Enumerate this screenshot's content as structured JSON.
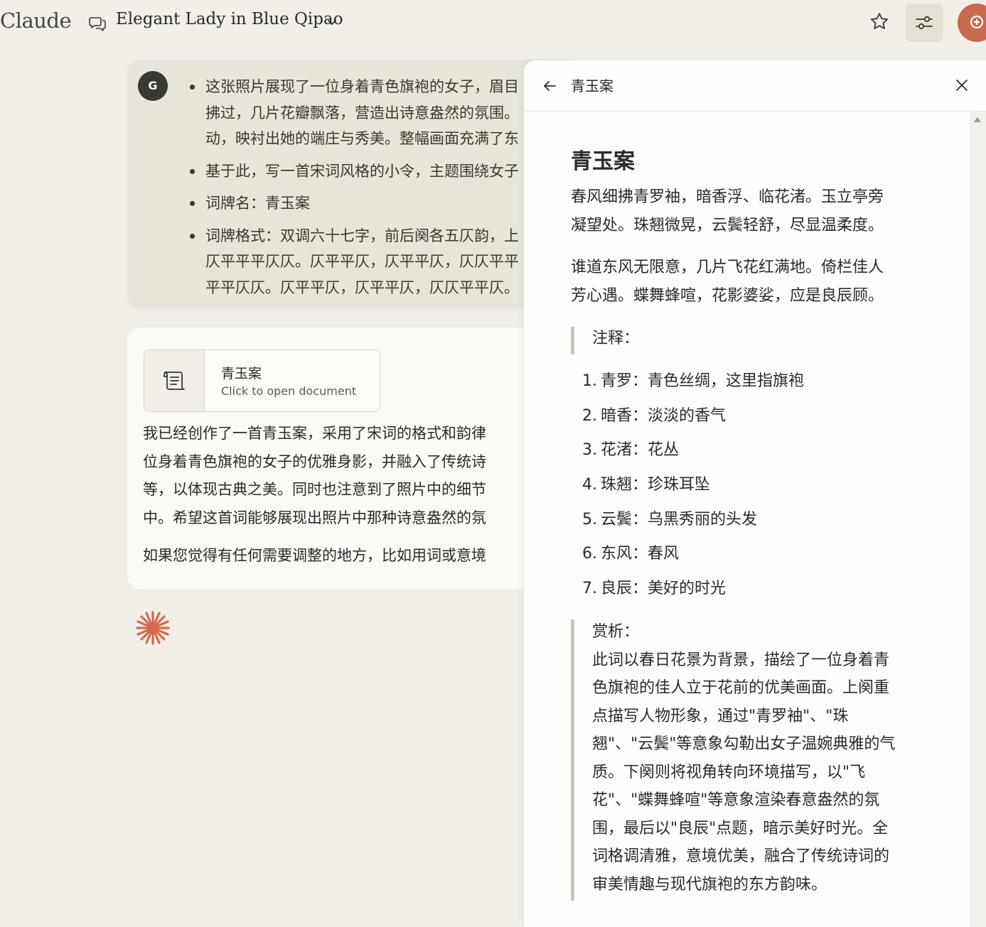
{
  "header": {
    "logo": "Claude",
    "conversation_title": "Elegant Lady in Blue Qipao",
    "icons": [
      "chat-bubbles-icon",
      "chevron-down-icon",
      "star-icon",
      "sliders-icon"
    ]
  },
  "user_message": {
    "avatar_initial": "G",
    "items": [
      "这张照片展现了一位身着青色旗袍的女子，眉目\n拂过，几片花瓣飘落，营造出诗意盎然的氛围。\n动，映衬出她的端庄与秀美。整幅画面充满了东",
      "基于此，写一首宋词风格的小令，主题围绕女子",
      "词牌名：青玉案",
      "词牌格式：双调六十七字，前后阕各五仄韵，上\n仄平平平仄仄。仄平平仄，仄平平仄，仄仄平平\n平平仄仄。仄平平仄，仄平平仄，仄仄平平仄。"
    ]
  },
  "assistant_message": {
    "doc_card": {
      "title": "青玉案",
      "subtitle": "Click to open document",
      "icon": "scroll-document-icon"
    },
    "para1": "我已经创作了一首青玉案，采用了宋词的格式和韵律\n位身着青色旗袍的女子的优雅身影，并融入了传统诗\n等，以体现古典之美。同时也注意到了照片中的细节\n中。希望这首词能够展现出照片中那种诗意盎然的氛",
    "para2": "如果您觉得有任何需要调整的地方，比如用词或意境"
  },
  "artifact_panel": {
    "header_title": "青玉案",
    "heading": "青玉案",
    "stanza1": "春风细拂青罗袖，暗香浮、临花渚。玉立亭旁\n凝望处。珠翘微晃，云鬓轻舒，尽显温柔度。",
    "stanza2": "谁道东风无限意，几片飞花红满地。倚栏佳人\n芳心遇。蝶舞蜂喧，花影婆娑，应是良辰顾。",
    "notes_label": "注释：",
    "notes": [
      {
        "num": "1.",
        "text": "青罗：青色丝绸，这里指旗袍"
      },
      {
        "num": "2.",
        "text": "暗香：淡淡的香气"
      },
      {
        "num": "3.",
        "text": "花渚：花丛"
      },
      {
        "num": "4.",
        "text": "珠翘：珍珠耳坠"
      },
      {
        "num": "5.",
        "text": "云鬓：乌黑秀丽的头发"
      },
      {
        "num": "6.",
        "text": "东风：春风"
      },
      {
        "num": "7.",
        "text": "良辰：美好的时光"
      }
    ],
    "analysis": "赏析：\n此词以春日花景为背景，描绘了一位身着青\n色旗袍的佳人立于花前的优美画面。上阕重\n点描写人物形象，通过\"青罗袖\"、\"珠\n翘\"、\"云鬓\"等意象勾勒出女子温婉典雅的气\n质。下阕则将视角转向环境描写，以\"飞\n花\"、\"蝶舞蜂喧\"等意象渲染春意盎然的氛\n围，最后以\"良辰\"点题，暗示美好时光。全\n词格调清雅，意境优美，融合了传统诗词的\n审美情趣与现代旗袍的东方韵味。"
  },
  "colors": {
    "background": "#f1efe8",
    "accent": "#c96a4c",
    "panel": "#fdfdfb"
  }
}
